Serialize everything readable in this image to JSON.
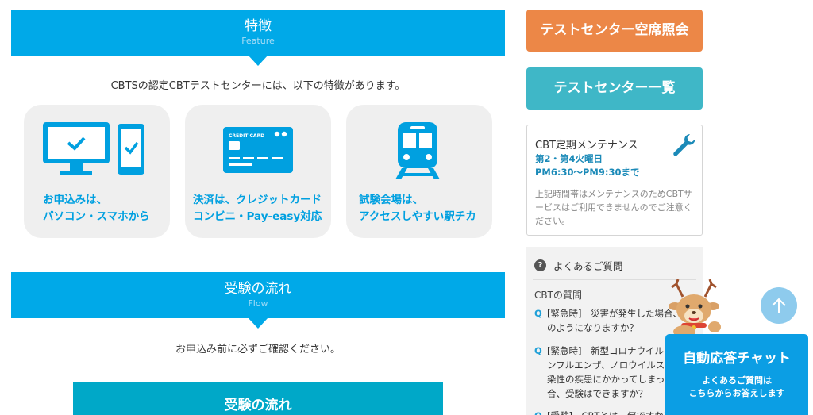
{
  "features": {
    "title": "特徴",
    "subtitle": "Feature",
    "intro": "CBTSの認定CBTテストセンターには、以下の特徴があります。",
    "cards": [
      {
        "icon": "pc-smartphone-icon",
        "line1": "お申込みは、",
        "line2": "パソコン・スマホから"
      },
      {
        "icon": "credit-card-icon",
        "line1": "決済は、クレジットカード",
        "line2": "コンビニ・Pay-easy対応",
        "card_text": "CREDIT CARD"
      },
      {
        "icon": "train-icon",
        "line1": "試験会場は、",
        "line2": "アクセスしやすい駅チカ"
      }
    ]
  },
  "flow": {
    "title": "受験の流れ",
    "subtitle": "Flow",
    "intro": "お申込み前に必ずご確認ください。",
    "button": "受験の流れ"
  },
  "sidebar": {
    "vacancy_button": "テストセンター空席照会",
    "list_button": "テストセンター一覧",
    "maintenance": {
      "title": "CBT定期メンテナンス",
      "days": "第2・第4火曜日",
      "time": "PM6:30〜PM9:30まで",
      "body": "上記時間帯はメンテナンスのためCBTサービスはご利用できませんのでご注意ください。"
    },
    "faq": {
      "title": "よくあるご質問",
      "category": "CBTの質問",
      "questions": [
        {
          "q": "Q",
          "text": "[緊急時]　災害が発生した場合、どのようになりますか？"
        },
        {
          "q": "Q",
          "text": "[緊急時]　新型コロナウイルス、インフルエンザ、ノロウイルスなど感染性の疾患にかかってしまった場合、受験はできますか？"
        },
        {
          "q": "Q",
          "text": "[受験]　CBTとは、何ですか？"
        }
      ]
    }
  },
  "chat": {
    "title": "自動応答チャット",
    "line1": "よくあるご質問は",
    "line2": "こちらからお答えします"
  },
  "colors": {
    "accent_blue": "#00a9e8",
    "orange": "#ec8747",
    "teal": "#3fb7c7",
    "chat_blue": "#0b9ee4"
  }
}
